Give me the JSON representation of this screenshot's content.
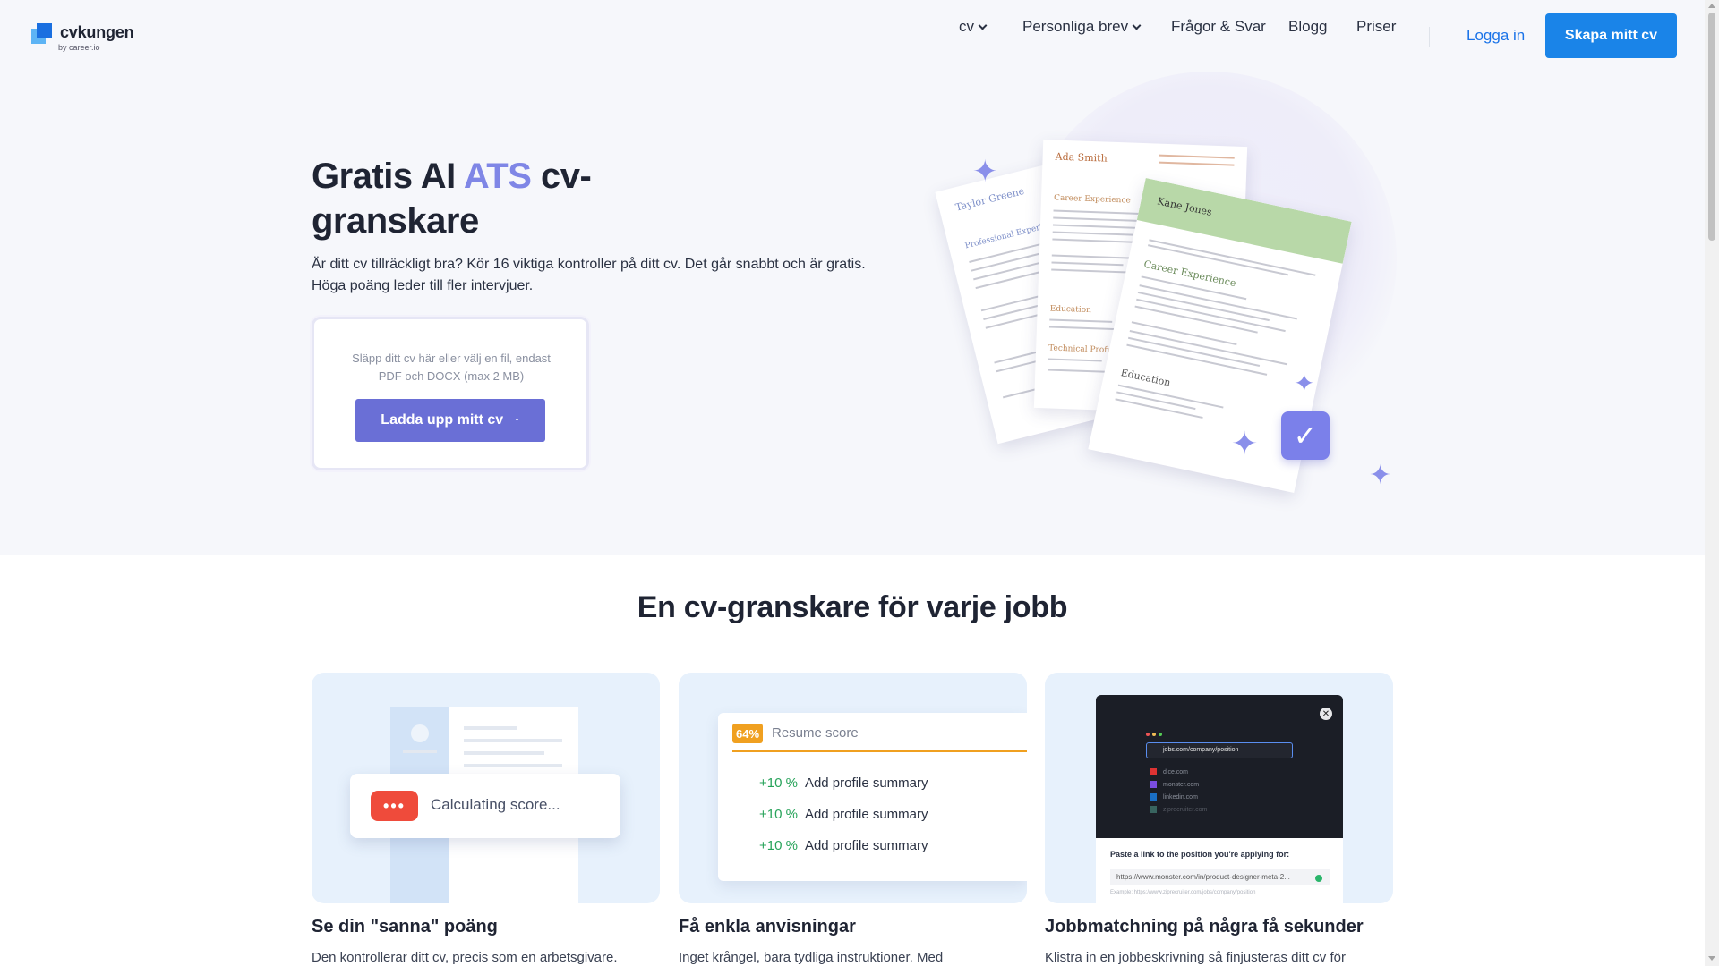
{
  "header": {
    "logo_text": "cvkungen",
    "logo_sub": "by career.io",
    "nav": [
      "cv",
      "Personliga brev",
      "Frågor & Svar",
      "Blogg",
      "Priser"
    ],
    "login": "Logga in",
    "cta": "Skapa mitt cv"
  },
  "hero": {
    "title_part1": "Gratis AI ",
    "title_accent": "ATS",
    "title_part2": " cv-granskare",
    "description": "Är ditt cv tillräckligt bra? Kör 16 viktiga kontroller på ditt cv. Det går snabbt och är gratis. Höga poäng leder till fler intervjuer.",
    "upload_hint": "Släpp ditt cv här eller välj en fil, endast PDF och DOCX (max 2 MB)",
    "upload_button": "Ladda upp mitt cv",
    "illustration": {
      "resume_names": [
        "Taylor Greene",
        "Ada Smith",
        "Kane Jones"
      ],
      "section_labels": [
        "Professional Experience",
        "Career Experience",
        "Education",
        "Technical Proficiencies",
        "Career Experience",
        "Education"
      ]
    }
  },
  "features": {
    "title": "En cv-granskare för varje jobb",
    "cards": [
      {
        "title": "Se din \"sanna\" poäng",
        "text": "Den kontrollerar ditt cv, precis som en arbetsgivare.",
        "visual_label": "Calculating score...",
        "visual_badge": "•••"
      },
      {
        "title": "Få enkla anvisningar",
        "text": "Inget krångel, bara tydliga instruktioner. Med",
        "score_badge": "64%",
        "score_label": "Resume score",
        "rows": [
          {
            "pct": "+10 %",
            "label": "Add profile summary"
          },
          {
            "pct": "+10 %",
            "label": "Add profile summary"
          },
          {
            "pct": "+10 %",
            "label": "Add profile summary"
          }
        ]
      },
      {
        "title": "Jobbmatchning på några få sekunder",
        "text": "Klistra in en jobbeskrivning så finjusteras ditt cv för",
        "url_bar": "jobs.com/company/position",
        "sites": [
          "dice.com",
          "monster.com",
          "linkedin.com",
          "ziprecruiter.com"
        ],
        "prompt": "Paste a link to the position you're applying for:",
        "input_value": "https://www.monster.com/in/product-designer-meta-2...",
        "example": "Example: https://www.ziprecruiter.com/jobs/company/position"
      }
    ]
  },
  "colors": {
    "accent_purple": "#7f86e6",
    "cta_blue": "#1a84e8",
    "upload_button": "#6a6fd6",
    "score_orange": "#f0a020",
    "gain_green": "#27a35a",
    "dots_red": "#ef4b3b"
  }
}
